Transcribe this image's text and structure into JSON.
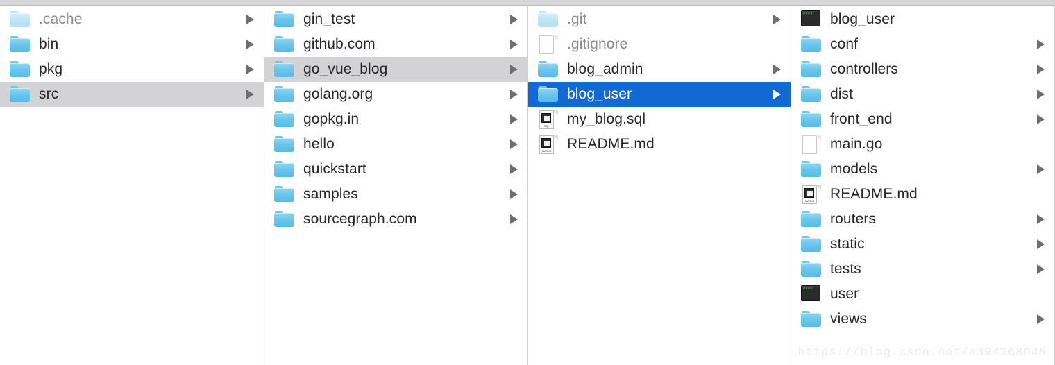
{
  "app": {
    "name": "Finder",
    "view_mode": "column-view",
    "watermark": "https://blog.csdn.net/a394268045"
  },
  "colors": {
    "selection_active": "#1269d3",
    "selection_inactive": "#d3d3d5",
    "folder_blue": "#6dc5ec",
    "text": "#25252a",
    "text_muted": "#8b8b90",
    "column_divider": "#cfcfd1",
    "watermark": "#eceaea"
  },
  "columns": [
    {
      "name": "column-1",
      "items": [
        {
          "label": ".cache",
          "icon": "folder-icon-dim",
          "muted": true,
          "has_arrow": true,
          "selection": "none"
        },
        {
          "label": "bin",
          "icon": "folder-icon",
          "muted": false,
          "has_arrow": true,
          "selection": "none"
        },
        {
          "label": "pkg",
          "icon": "folder-icon",
          "muted": false,
          "has_arrow": true,
          "selection": "none"
        },
        {
          "label": "src",
          "icon": "folder-icon",
          "muted": false,
          "has_arrow": true,
          "selection": "inactive"
        }
      ]
    },
    {
      "name": "column-2",
      "items": [
        {
          "label": "gin_test",
          "icon": "folder-icon",
          "muted": false,
          "has_arrow": true,
          "selection": "none"
        },
        {
          "label": "github.com",
          "icon": "folder-icon",
          "muted": false,
          "has_arrow": true,
          "selection": "none"
        },
        {
          "label": "go_vue_blog",
          "icon": "folder-icon",
          "muted": false,
          "has_arrow": true,
          "selection": "inactive"
        },
        {
          "label": "golang.org",
          "icon": "folder-icon",
          "muted": false,
          "has_arrow": true,
          "selection": "none"
        },
        {
          "label": "gopkg.in",
          "icon": "folder-icon",
          "muted": false,
          "has_arrow": true,
          "selection": "none"
        },
        {
          "label": "hello",
          "icon": "folder-icon",
          "muted": false,
          "has_arrow": true,
          "selection": "none"
        },
        {
          "label": "quickstart",
          "icon": "folder-icon",
          "muted": false,
          "has_arrow": true,
          "selection": "none"
        },
        {
          "label": "samples",
          "icon": "folder-icon",
          "muted": false,
          "has_arrow": true,
          "selection": "none"
        },
        {
          "label": "sourcegraph.com",
          "icon": "folder-icon",
          "muted": false,
          "has_arrow": true,
          "selection": "none"
        }
      ]
    },
    {
      "name": "column-3",
      "items": [
        {
          "label": ".git",
          "icon": "folder-icon-dim",
          "muted": true,
          "has_arrow": true,
          "selection": "none"
        },
        {
          "label": ".gitignore",
          "icon": "document-icon",
          "muted": true,
          "has_arrow": false,
          "selection": "none"
        },
        {
          "label": "blog_admin",
          "icon": "folder-icon",
          "muted": false,
          "has_arrow": true,
          "selection": "none"
        },
        {
          "label": "blog_user",
          "icon": "folder-icon",
          "muted": false,
          "has_arrow": true,
          "selection": "active"
        },
        {
          "label": "my_blog.sql",
          "icon": "sql-file-icon",
          "muted": false,
          "has_arrow": false,
          "selection": "none",
          "kind": "SQL"
        },
        {
          "label": "README.md",
          "icon": "markdown-file-icon",
          "muted": false,
          "has_arrow": false,
          "selection": "none",
          "kind": "MARKD"
        }
      ]
    },
    {
      "name": "column-4",
      "items": [
        {
          "label": "blog_user",
          "icon": "unix-executable-icon",
          "muted": false,
          "has_arrow": false,
          "selection": "none",
          "prompt": "####"
        },
        {
          "label": "conf",
          "icon": "folder-icon",
          "muted": false,
          "has_arrow": true,
          "selection": "none"
        },
        {
          "label": "controllers",
          "icon": "folder-icon",
          "muted": false,
          "has_arrow": true,
          "selection": "none"
        },
        {
          "label": "dist",
          "icon": "folder-icon",
          "muted": false,
          "has_arrow": true,
          "selection": "none"
        },
        {
          "label": "front_end",
          "icon": "folder-icon",
          "muted": false,
          "has_arrow": true,
          "selection": "none"
        },
        {
          "label": "main.go",
          "icon": "document-icon",
          "muted": false,
          "has_arrow": false,
          "selection": "none"
        },
        {
          "label": "models",
          "icon": "folder-icon",
          "muted": false,
          "has_arrow": true,
          "selection": "none"
        },
        {
          "label": "README.md",
          "icon": "markdown-file-icon",
          "muted": false,
          "has_arrow": false,
          "selection": "none",
          "kind": "MARKD"
        },
        {
          "label": "routers",
          "icon": "folder-icon",
          "muted": false,
          "has_arrow": true,
          "selection": "none"
        },
        {
          "label": "static",
          "icon": "folder-icon",
          "muted": false,
          "has_arrow": true,
          "selection": "none"
        },
        {
          "label": "tests",
          "icon": "folder-icon",
          "muted": false,
          "has_arrow": true,
          "selection": "none"
        },
        {
          "label": "user",
          "icon": "unix-executable-icon",
          "muted": false,
          "has_arrow": false,
          "selection": "none",
          "prompt": "####"
        },
        {
          "label": "views",
          "icon": "folder-icon",
          "muted": false,
          "has_arrow": true,
          "selection": "none"
        }
      ]
    }
  ]
}
